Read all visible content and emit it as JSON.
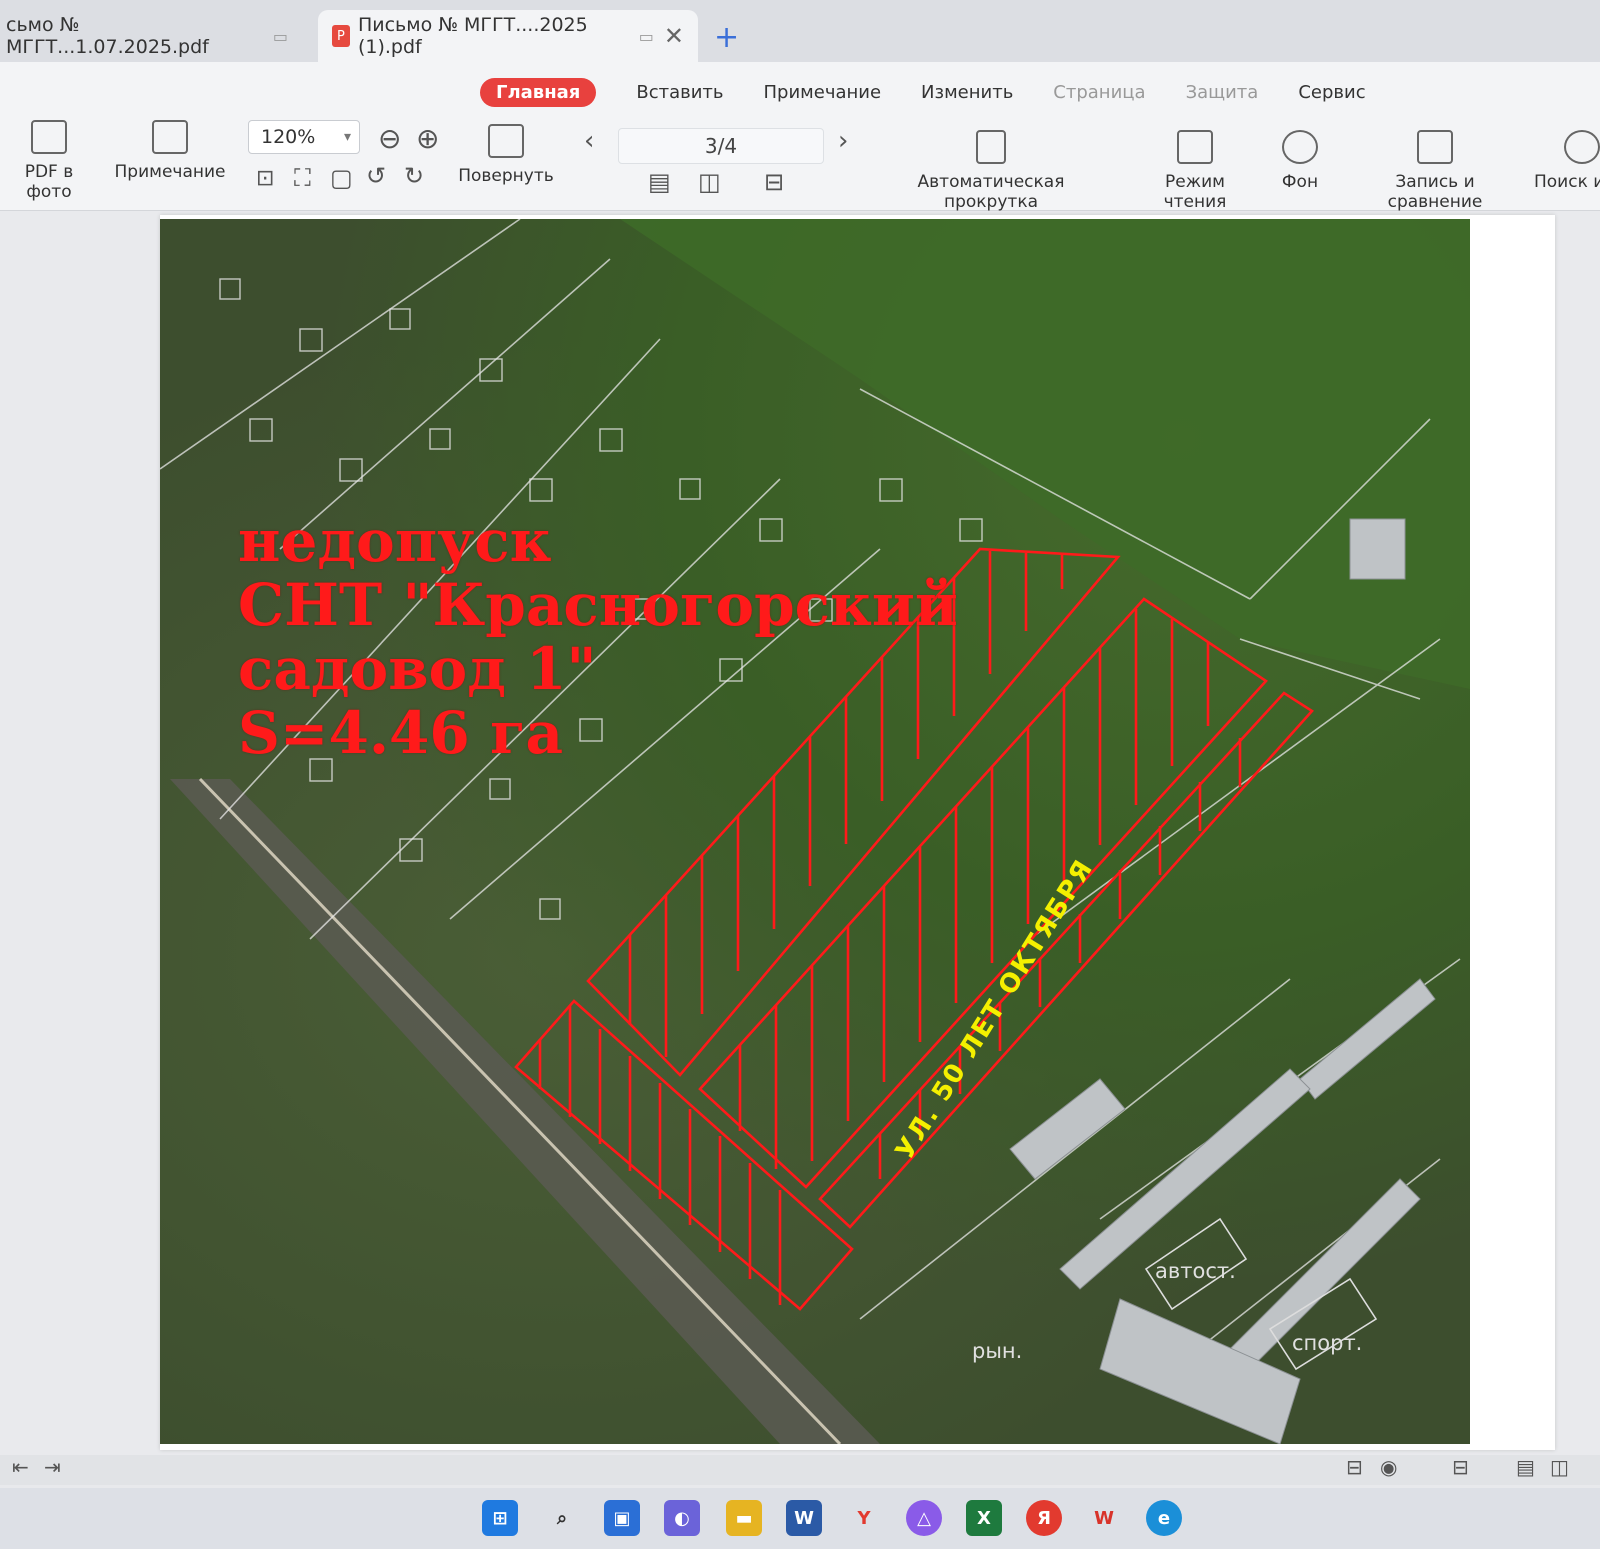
{
  "tabs": [
    {
      "label": "сьмо № МГГТ...1.07.2025.pdf"
    },
    {
      "label": "Письмо № МГГТ....2025 (1).pdf"
    }
  ],
  "menu": {
    "home": "Главная",
    "insert": "Вставить",
    "note": "Примечание",
    "edit": "Изменить",
    "page": "Страница",
    "protect": "Защита",
    "service": "Сервис"
  },
  "toolbar": {
    "pdf_to_photo": "PDF в фото",
    "note": "Примечание",
    "zoom": "120%",
    "rotate": "Повернуть",
    "page_indicator": "3/4",
    "autoscroll": "Автоматическая прокрутка",
    "reading_mode": "Режим чтения",
    "background": "Фон",
    "record_compare": "Запись и сравнение",
    "search": "Поиск и"
  },
  "map": {
    "annotation_line1": "недопуск",
    "annotation_line2": "СНТ \"Красногорский",
    "annotation_line3": "садовод 1\"",
    "annotation_line4": "S=4.46 га",
    "street": "УЛ. 50 ЛЕТ ОКТЯБРЯ",
    "label_avtost": "автост.",
    "label_sport": "спорт.",
    "label_ryn": "рын."
  },
  "colors": {
    "accent": "#e8413e",
    "hatch": "#ff1a1a",
    "street_text": "#f4f000"
  }
}
